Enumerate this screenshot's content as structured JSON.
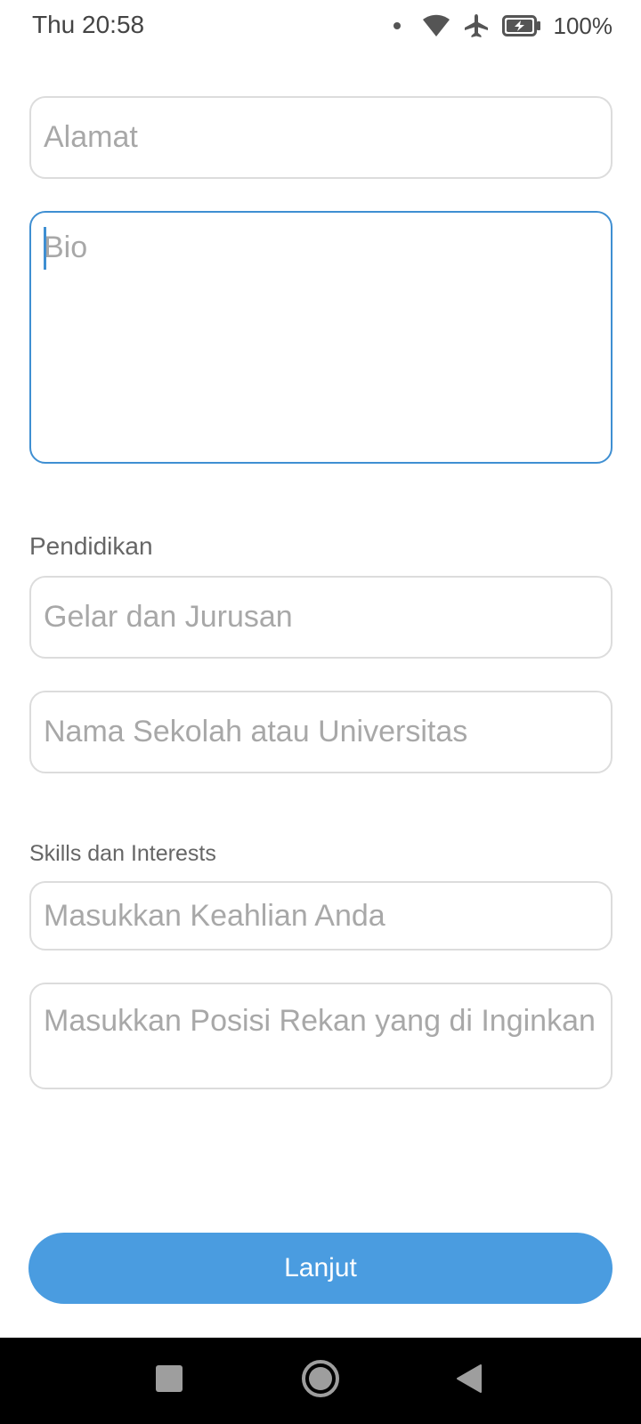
{
  "status_bar": {
    "time": "Thu 20:58",
    "battery": "100%",
    "icons": [
      "notification-dot-icon",
      "wifi-icon",
      "airplane-icon",
      "battery-charging-icon"
    ]
  },
  "form": {
    "address_placeholder": "Alamat",
    "bio_placeholder": "Bio",
    "education": {
      "label": "Pendidikan",
      "degree_placeholder": "Gelar dan Jurusan",
      "school_placeholder": "Nama Sekolah atau Universitas"
    },
    "skills": {
      "label": "Skills dan Interests",
      "skills_placeholder": "Masukkan Keahlian Anda",
      "position_placeholder": "Masukkan Posisi Rekan yang di Inginkan"
    },
    "next_label": "Lanjut"
  },
  "nav": {
    "icons": [
      "recents-square-icon",
      "home-circle-icon",
      "back-triangle-icon"
    ]
  },
  "colors": {
    "accent": "#4a9ce0",
    "focus_border": "#3f8fd2",
    "field_border": "#dcdcdc",
    "placeholder": "#a8a8a8"
  }
}
